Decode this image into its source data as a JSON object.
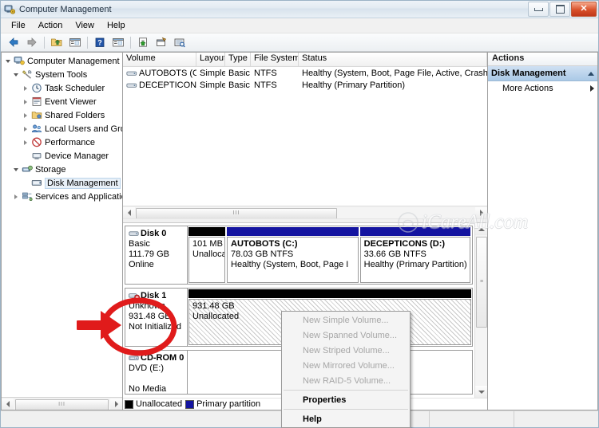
{
  "window": {
    "title": "Computer Management",
    "icon": "computer-management-icon",
    "buttons": {
      "minimize": "–",
      "maximize": "□",
      "close": "✕"
    }
  },
  "menu": {
    "items": [
      {
        "label": "File",
        "name": "menu-file"
      },
      {
        "label": "Action",
        "name": "menu-action"
      },
      {
        "label": "View",
        "name": "menu-view"
      },
      {
        "label": "Help",
        "name": "menu-help"
      }
    ]
  },
  "toolbar": {
    "buttons": [
      {
        "name": "back-button",
        "icon": "arrow-left-icon"
      },
      {
        "name": "forward-button",
        "icon": "arrow-right-icon"
      },
      {
        "name": "up-folder-button",
        "icon": "folder-up-icon"
      },
      {
        "name": "show-hide-tree-button",
        "icon": "window-list-icon"
      },
      {
        "name": "help-button",
        "icon": "question-mark-icon"
      },
      {
        "name": "properties-list-button",
        "icon": "window-list-icon"
      },
      {
        "name": "refresh-button",
        "icon": "refresh-page-icon"
      },
      {
        "name": "properties-button",
        "icon": "properties-icon"
      },
      {
        "name": "rescan-disks-button",
        "icon": "rescan-disks-icon"
      }
    ]
  },
  "tree": {
    "items": [
      {
        "label": "Computer Management (Local",
        "depth": 0,
        "twisty": "open",
        "icon": "computer-icon",
        "selected": false,
        "name": "tree-item-computer-management"
      },
      {
        "label": "System Tools",
        "depth": 1,
        "twisty": "open",
        "icon": "system-tools-icon",
        "selected": false,
        "name": "tree-item-system-tools"
      },
      {
        "label": "Task Scheduler",
        "depth": 2,
        "twisty": "closed",
        "icon": "clock-icon",
        "selected": false,
        "name": "tree-item-task-scheduler"
      },
      {
        "label": "Event Viewer",
        "depth": 2,
        "twisty": "closed",
        "icon": "event-viewer-icon",
        "selected": false,
        "name": "tree-item-event-viewer"
      },
      {
        "label": "Shared Folders",
        "depth": 2,
        "twisty": "closed",
        "icon": "shared-folders-icon",
        "selected": false,
        "name": "tree-item-shared-folders"
      },
      {
        "label": "Local Users and Groups",
        "depth": 2,
        "twisty": "closed",
        "icon": "users-group-icon",
        "selected": false,
        "name": "tree-item-local-users-and-groups"
      },
      {
        "label": "Performance",
        "depth": 2,
        "twisty": "closed",
        "icon": "performance-icon",
        "selected": false,
        "name": "tree-item-performance"
      },
      {
        "label": "Device Manager",
        "depth": 2,
        "twisty": "none",
        "icon": "device-manager-icon",
        "selected": false,
        "name": "tree-item-device-manager"
      },
      {
        "label": "Storage",
        "depth": 1,
        "twisty": "open",
        "icon": "storage-icon",
        "selected": false,
        "name": "tree-item-storage"
      },
      {
        "label": "Disk Management",
        "depth": 2,
        "twisty": "none",
        "icon": "disk-management-icon",
        "selected": true,
        "name": "tree-item-disk-management"
      },
      {
        "label": "Services and Applications",
        "depth": 1,
        "twisty": "closed",
        "icon": "services-icon",
        "selected": false,
        "name": "tree-item-services-and-applications"
      }
    ]
  },
  "volume_list": {
    "columns": [
      {
        "label": "Volume",
        "name": "column-header-volume"
      },
      {
        "label": "Layout",
        "name": "column-header-layout"
      },
      {
        "label": "Type",
        "name": "column-header-type"
      },
      {
        "label": "File System",
        "name": "column-header-file-system"
      },
      {
        "label": "Status",
        "name": "column-header-status"
      }
    ],
    "rows": [
      {
        "volume": "AUTOBOTS (C:)",
        "layout": "Simple",
        "type": "Basic",
        "file_system": "NTFS",
        "status": "Healthy (System, Boot, Page File, Active, Crash Dump, Prin"
      },
      {
        "volume": "DECEPTICONS (D:)",
        "layout": "Simple",
        "type": "Basic",
        "file_system": "NTFS",
        "status": "Healthy (Primary Partition)"
      }
    ]
  },
  "disks": [
    {
      "name": "disk-0",
      "title": "Disk 0",
      "kind": "Basic",
      "capacity": "111.79 GB",
      "state": "Online",
      "bar_segments": [
        {
          "color": "#000000",
          "width_pct": 7
        },
        {
          "color": "#1414a0",
          "width_pct": 58
        },
        {
          "color": "#1414a0",
          "width_pct": 35
        }
      ],
      "partitions": [
        {
          "name": "",
          "size": "101 MB",
          "status": "Unallocate",
          "width_pct": 13,
          "style": "plain"
        },
        {
          "name": "AUTOBOTS  (C:)",
          "size": "78.03 GB NTFS",
          "status": "Healthy (System, Boot, Page I",
          "width_pct": 46,
          "style": "plain"
        },
        {
          "name": "DECEPTICONS  (D:)",
          "size": "33.66 GB NTFS",
          "status": "Healthy (Primary Partition)",
          "width_pct": 41,
          "style": "plain"
        }
      ]
    },
    {
      "name": "disk-1",
      "title": "Disk 1",
      "kind": "Unknown",
      "capacity": "931.48 GB",
      "state": "Not Initialized",
      "bar_segments": [
        {
          "color": "#000000",
          "width_pct": 100
        }
      ],
      "partitions": [
        {
          "name": "",
          "size": "931.48 GB",
          "status": "Unallocated",
          "width_pct": 100,
          "style": "unalloc-hatch"
        }
      ]
    }
  ],
  "cdrom": {
    "name": "cdrom-0",
    "title": "CD-ROM 0",
    "kind": "DVD (E:)",
    "capacity": "",
    "state": "No Media"
  },
  "legend": {
    "items": [
      {
        "label": "Unallocated",
        "color": "#000000",
        "name": "legend-unallocated"
      },
      {
        "label": "Primary partition",
        "color": "#1414a0",
        "name": "legend-primary-partition"
      }
    ]
  },
  "actions": {
    "header": "Actions",
    "group_title": "Disk Management",
    "items": [
      {
        "label": "More Actions",
        "name": "action-more-actions"
      }
    ]
  },
  "context_menu": {
    "items": [
      {
        "label": "New Simple Volume...",
        "enabled": false,
        "name": "menu-new-simple-volume"
      },
      {
        "label": "New Spanned Volume...",
        "enabled": false,
        "name": "menu-new-spanned-volume"
      },
      {
        "label": "New Striped Volume...",
        "enabled": false,
        "name": "menu-new-striped-volume"
      },
      {
        "label": "New Mirrored Volume...",
        "enabled": false,
        "name": "menu-new-mirrored-volume"
      },
      {
        "label": "New RAID-5 Volume...",
        "enabled": false,
        "name": "menu-new-raid5-volume"
      },
      {
        "label": "Properties",
        "enabled": true,
        "name": "menu-properties"
      },
      {
        "label": "Help",
        "enabled": true,
        "name": "menu-help-item"
      }
    ]
  },
  "watermark": {
    "text": "iCareAll.com"
  },
  "annotation": {
    "color": "#e01b1b",
    "shape": "red-circle-with-arrow"
  },
  "colors": {
    "unallocated": "#000000",
    "primary_partition": "#1414a0",
    "selection": "#aac9e6",
    "close_button": "#d9512a"
  }
}
